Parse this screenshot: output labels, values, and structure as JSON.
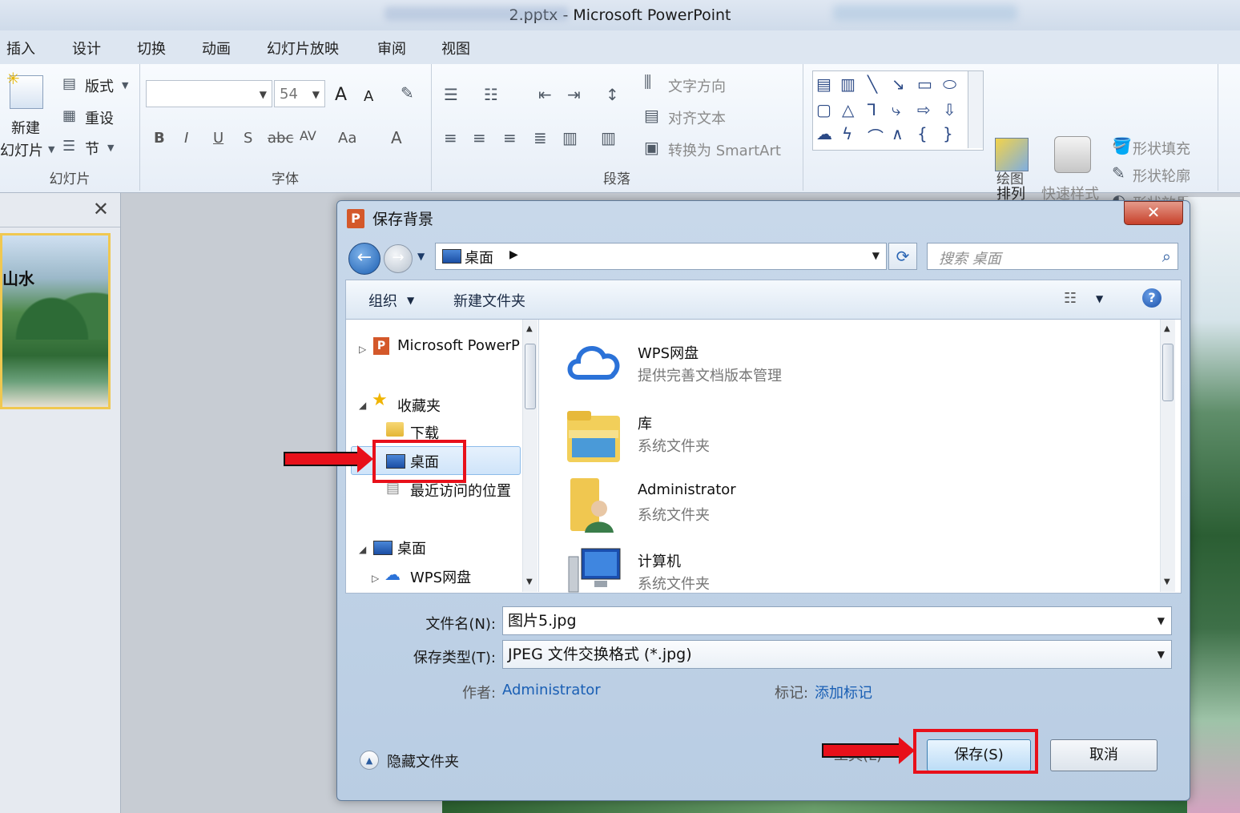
{
  "window": {
    "title": "2.pptx - Microsoft PowerPoint"
  },
  "tabs": [
    "插入",
    "设计",
    "切换",
    "动画",
    "幻灯片放映",
    "审阅",
    "视图"
  ],
  "ribbon": {
    "slides": {
      "new_slide_1": "新建",
      "new_slide_2": "幻灯片",
      "layout": "版式",
      "reset": "重设",
      "section": "节",
      "label": "幻灯片"
    },
    "font": {
      "font_size": "54",
      "bold": "B",
      "italic": "I",
      "underline": "U",
      "shadow": "S",
      "strike": "abc",
      "spacing": "AV",
      "case": "Aa",
      "color": "A",
      "grow": "A",
      "shrink": "A",
      "label": "字体"
    },
    "paragraph": {
      "text_direction": "文字方向",
      "align_text": "对齐文本",
      "smartart": "转换为 SmartArt",
      "label": "段落"
    },
    "drawing": {
      "arrange": "排列",
      "quick_styles": "快速样式",
      "shape_fill": "形状填充",
      "shape_outline": "形状轮廓",
      "shape_effects": "形状效果",
      "label": "绘图"
    }
  },
  "slide_pane": {
    "thumb_text": "山水"
  },
  "dialog": {
    "title": "保存背景",
    "address": "桌面",
    "search_placeholder": "搜索 桌面",
    "toolbar": {
      "organize": "组织",
      "new_folder": "新建文件夹"
    },
    "nav": [
      {
        "label": "Microsoft PowerP"
      },
      {
        "label": "收藏夹"
      },
      {
        "label": "下载"
      },
      {
        "label": "桌面"
      },
      {
        "label": "最近访问的位置"
      },
      {
        "label": "桌面"
      },
      {
        "label": "WPS网盘"
      }
    ],
    "items": [
      {
        "name": "WPS网盘",
        "sub": "提供完善文档版本管理"
      },
      {
        "name": "库",
        "sub": "系统文件夹"
      },
      {
        "name": "Administrator",
        "sub": "系统文件夹"
      },
      {
        "name": "计算机",
        "sub": "系统文件夹"
      }
    ],
    "filename_label": "文件名(N):",
    "filename_value": "图片5.jpg",
    "filetype_label": "保存类型(T):",
    "filetype_value": "JPEG 文件交换格式 (*.jpg)",
    "author_label": "作者:",
    "author_value": "Administrator",
    "tags_label": "标记:",
    "tags_value": "添加标记",
    "hide_folders": "隐藏文件夹",
    "tools": "工具(L)",
    "save": "保存(S)",
    "cancel": "取消"
  },
  "colors": {
    "annotation": "#e8101a",
    "link": "#1a5fb4"
  }
}
